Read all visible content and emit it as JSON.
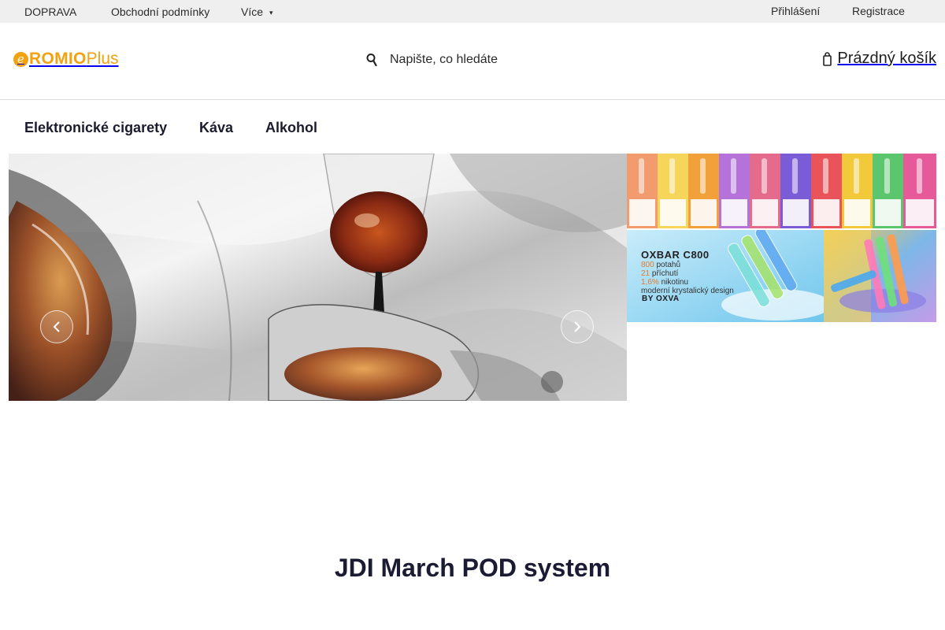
{
  "topbar": {
    "links": [
      "DOPRAVA",
      "Obchodní podmínky",
      "Více"
    ],
    "login": "Přihlášení",
    "register": "Registrace"
  },
  "header": {
    "logo_text": "ROMIO",
    "logo_plus": "Plus",
    "logo_mark": "e",
    "search_placeholder": "Napište, co hledáte",
    "search_icon": "search-icon",
    "cart_label": "Prázdný košík",
    "cart_icon": "cart-icon"
  },
  "nav": {
    "items": [
      "Elektronické cigarety",
      "Káva",
      "Alkohol"
    ]
  },
  "hero": {
    "prev_icon": "chevron-left-icon",
    "next_icon": "chevron-right-icon"
  },
  "banners": {
    "oxbar_title": "OXBAR C800",
    "oxbar_lines": [
      {
        "num": "800",
        "text": " potahů"
      },
      {
        "num": "21",
        "text": " příchutí"
      },
      {
        "num": "1,6%",
        "text": " nikotinu"
      },
      {
        "num": "",
        "text": "moderní krystalický design"
      }
    ],
    "oxbar_by": "BY OXVA"
  },
  "main": {
    "headline": "JDI March POD system"
  },
  "colors": {
    "brand_orange": "#f2a20e",
    "topbar_bg": "#efefef",
    "heading": "#1b1b33"
  }
}
